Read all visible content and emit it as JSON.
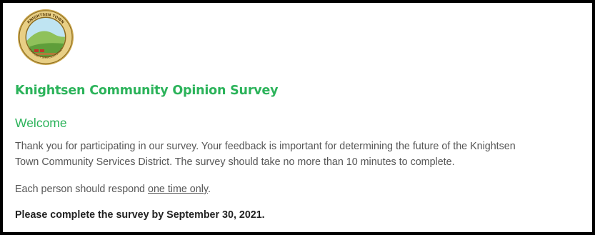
{
  "logo": {
    "name": "Knightsen Town Community Services District seal",
    "arc_top": "KNIGHTSEN TOWN",
    "arc_bottom": "COMMUNITY SERVICES DISTRICT"
  },
  "survey": {
    "title": "Knightsen Community Opinion Survey",
    "section_title": "Welcome",
    "intro_1": "Thank you for participating in our survey. Your feedback is important for determining the future of the Knightsen",
    "intro_2": "Town Community Services District.  The survey should take no more than 10 minutes to complete.",
    "respond_prefix": "Each person should respond ",
    "respond_emphasis": "one time only",
    "respond_suffix": ".",
    "deadline": "Please complete the survey by September 30, 2021."
  },
  "colors": {
    "accent": "#2bb35a",
    "body_text": "#555555",
    "deadline_text": "#222222",
    "frame": "#000000"
  }
}
